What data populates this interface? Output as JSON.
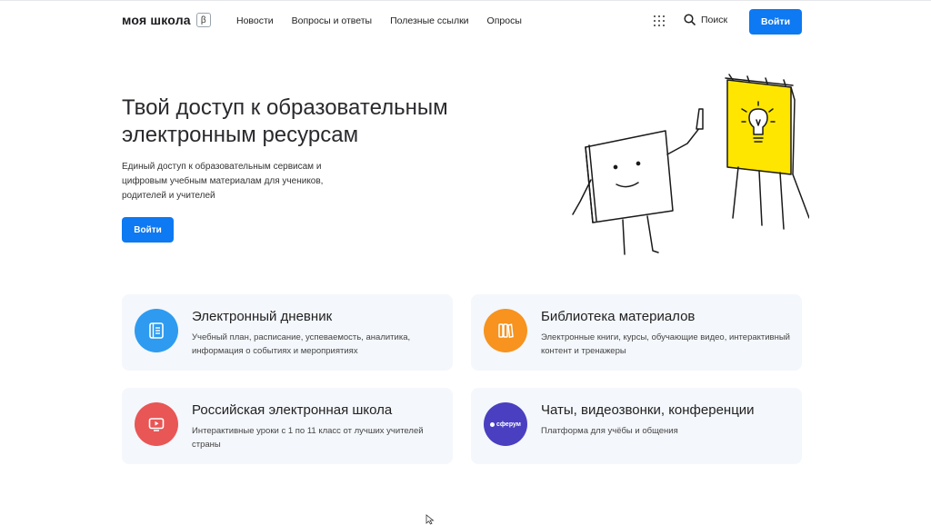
{
  "header": {
    "logo": "моя школа",
    "beta": "β",
    "nav": [
      "Новости",
      "Вопросы и ответы",
      "Полезные ссылки",
      "Опросы"
    ],
    "search_label": "Поиск",
    "login_label": "Войти"
  },
  "hero": {
    "title_line1": "Твой доступ к образовательным",
    "title_line2": "электронным ресурсам",
    "description": "Единый доступ к образовательным сервисам и цифровым учебным материалам для учеников, родителей и учителей",
    "login_label": "Войти"
  },
  "cards": [
    {
      "title": "Электронный дневник",
      "description": "Учебный план, расписание, успеваемость, аналитика, информация о событиях и мероприятиях",
      "icon": "diary-icon",
      "color": "#2e9bf0"
    },
    {
      "title": "Библиотека материалов",
      "description": "Электронные книги, курсы, обучающие видео, интерактивный контент и тренажеры",
      "icon": "books-icon",
      "color": "#f7931e"
    },
    {
      "title": "Российская электронная школа",
      "description": "Интерактивные уроки с 1 по 11 класс от лучших учителей страны",
      "icon": "video-play-icon",
      "color": "#e85656"
    },
    {
      "title": "Чаты, видеозвонки, конференции",
      "description": "Платформа для учёбы и общения",
      "icon": "sferum-logo",
      "color": "#4a3fc0",
      "logo_text": "сферум"
    }
  ],
  "colors": {
    "primary": "#0d79f2",
    "card_bg": "#f4f7fb",
    "illustration_yellow": "#ffe600"
  }
}
